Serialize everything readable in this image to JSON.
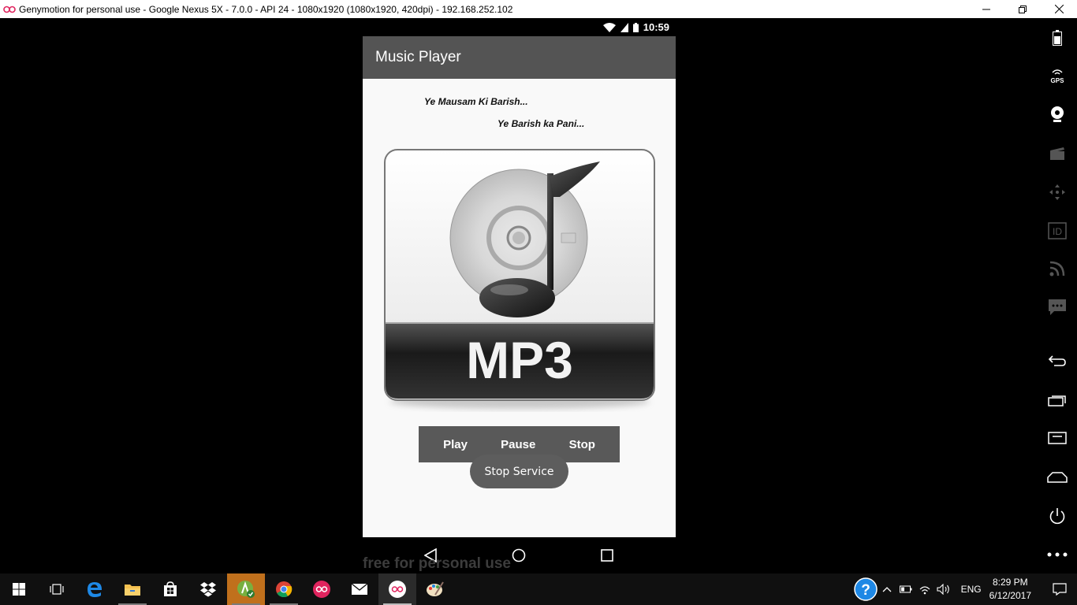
{
  "window": {
    "title": "Genymotion for personal use - Google Nexus 5X - 7.0.0 - API 24 - 1080x1920 (1080x1920, 420dpi) - 192.168.252.102",
    "minimize_icon": "minimize-icon",
    "restore_icon": "restore-icon",
    "close_icon": "close-icon"
  },
  "status_bar": {
    "time": "10:59",
    "icons": [
      "wifi-icon",
      "signal-icon",
      "battery-icon"
    ]
  },
  "app_bar": {
    "title": "Music Player"
  },
  "lyrics": {
    "line1": "Ye Mausam Ki Barish...",
    "line2": "Ye Barish ka Pani..."
  },
  "album_art": {
    "label": "MP3"
  },
  "controls": {
    "play": "Play",
    "pause": "Pause",
    "stop": "Stop"
  },
  "toast": {
    "text": "Stop Service"
  },
  "watermark": "free for personal use",
  "side_toolbar": [
    "battery-icon",
    "gps-icon",
    "camera-icon",
    "media-icon",
    "move-icon",
    "id-icon",
    "rss-icon",
    "sms-icon",
    "back-icon",
    "recent-apps-icon",
    "menu-icon",
    "home-icon",
    "power-icon",
    "more-icon"
  ],
  "gps_label": "GPS",
  "id_label": "ID",
  "taskbar": {
    "lang": "ENG",
    "time": "8:29 PM",
    "date": "6/12/2017"
  },
  "colors": {
    "appbar": "#545454",
    "controls_bg": "#595959",
    "toast_bg": "#5d5d5d"
  }
}
